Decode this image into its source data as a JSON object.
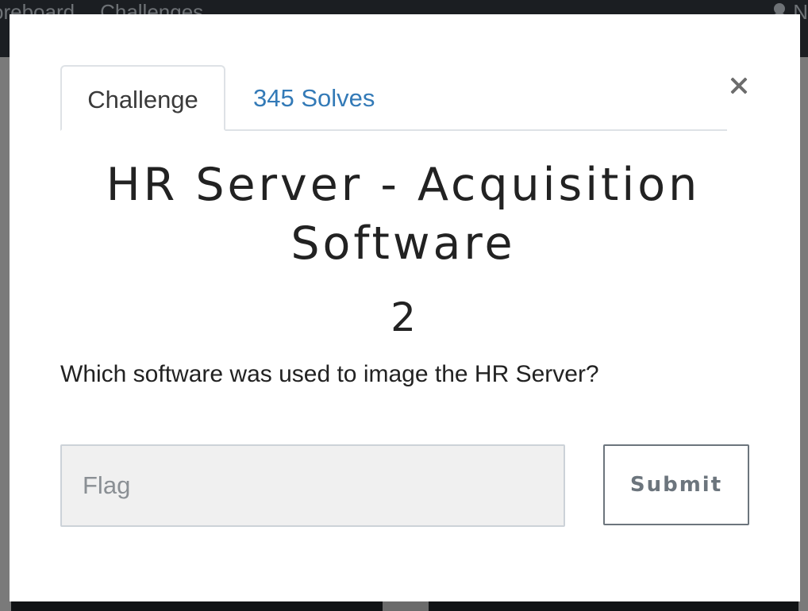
{
  "navbar": {
    "links": [
      "oreboard",
      "Challenges"
    ],
    "user_label": "N"
  },
  "modal": {
    "tabs": {
      "challenge_label": "Challenge",
      "solves_label": "345 Solves"
    },
    "title": "HR Server - Acquisition Software",
    "value": "2",
    "description": "Which software was used to image the HR Server?",
    "flag_input": {
      "value": "",
      "placeholder": "Flag"
    },
    "submit_label": "Submit"
  },
  "colors": {
    "navbar_bg": "#1b1e22",
    "backdrop": "#7a7a7a",
    "tab_link": "#337ab7",
    "submit_border": "#6c757d",
    "input_bg": "#f0f0f0"
  },
  "icons": {
    "close": "close-icon",
    "user": "user-icon"
  }
}
